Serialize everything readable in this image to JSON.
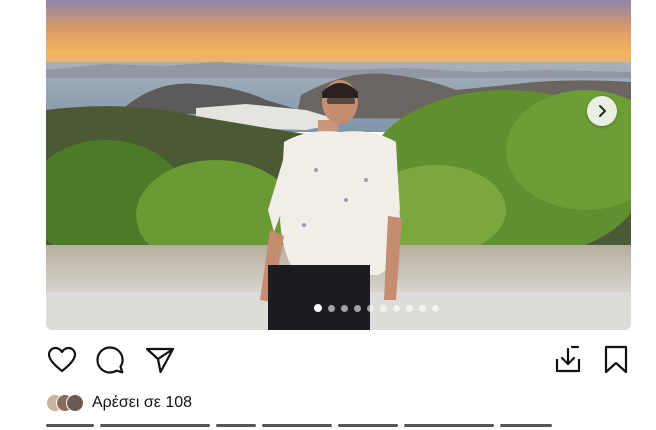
{
  "post": {
    "photo_icon": "sunset-portrait-photo",
    "next_icon": "chevron-right-icon",
    "carousel_count": 10,
    "carousel_active": 1
  },
  "actions": {
    "like_icon": "heart-icon",
    "comment_icon": "comment-icon",
    "share_icon": "send-icon",
    "download_icon": "download-icon",
    "save_icon": "bookmark-icon"
  },
  "likes": {
    "text": "Αρέσει σε 108"
  },
  "colors": {
    "sky_top": "#7d7aa8",
    "sky_mid": "#e79a4a",
    "horizon": "#f2b45e",
    "sea": "#8ea3b5",
    "foliage": "#5d8a2e",
    "wall": "#c9c4b9"
  }
}
